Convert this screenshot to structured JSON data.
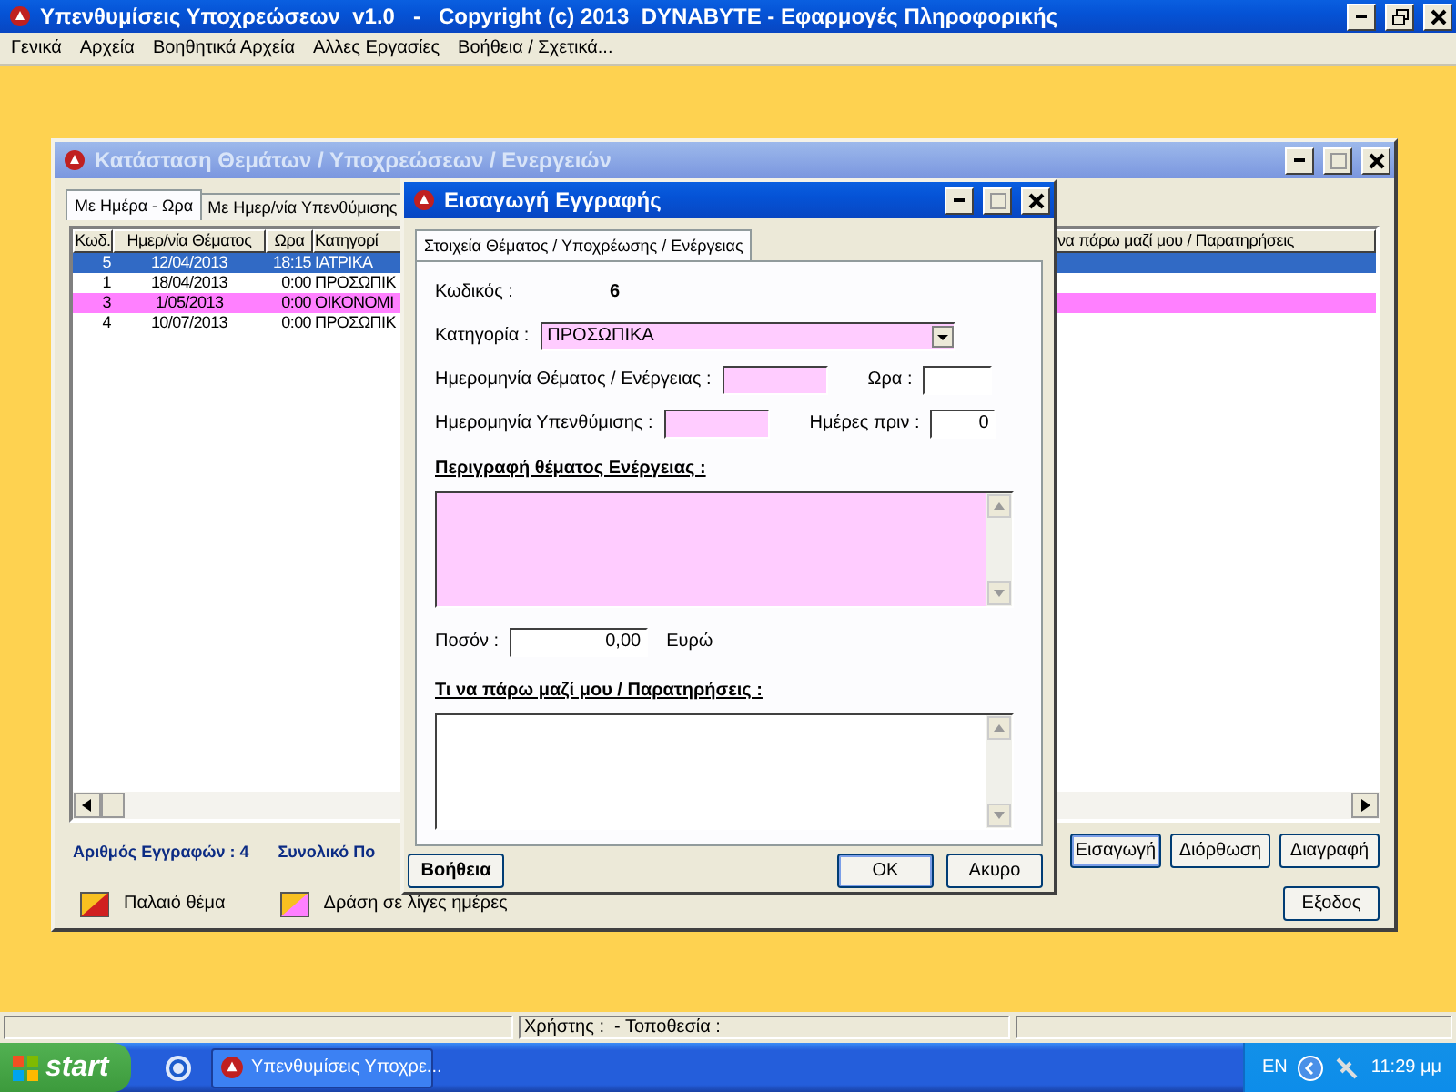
{
  "app": {
    "title": "Υπενθυμίσεις Υποχρεώσεων  v1.0   -   Copyright (c) 2013  DYNABYTE - Εφαρμογές Πληροφορικής"
  },
  "menu": [
    "Γενικά",
    "Αρχεία",
    "Βοηθητικά Αρχεία",
    "Αλλες Εργασίες",
    "Βοήθεια / Σχετικά..."
  ],
  "list_window": {
    "title": "Κατάσταση Θεμάτων / Υποχρεώσεων / Ενεργειών",
    "tabs": [
      {
        "label": "Με Ημέρα - Ωρα",
        "selected": true
      },
      {
        "label": "Με Ημερ/νία Υπενθύμισης",
        "selected": false
      }
    ],
    "columns": [
      "Κωδ.",
      "Ημερ/νία Θέματος",
      "Ωρα",
      "Κατηγορί",
      "να πάρω μαζί μου / Παρατηρήσεις"
    ],
    "rows": [
      {
        "code": "5",
        "date": "12/04/2013",
        "time": "18:15",
        "category": "ΙΑΤΡΙΚΑ",
        "selected": true,
        "kind": "normal"
      },
      {
        "code": "1",
        "date": "18/04/2013",
        "time": "0:00",
        "category": "ΠΡΟΣΩΠΙΚ",
        "selected": false,
        "kind": "normal"
      },
      {
        "code": "3",
        "date": "1/05/2013",
        "time": "0:00",
        "category": "ΟΙΚΟΝΟΜΙ",
        "selected": false,
        "kind": "soon"
      },
      {
        "code": "4",
        "date": "10/07/2013",
        "time": "0:00",
        "category": "ΠΡΟΣΩΠΙΚ",
        "selected": false,
        "kind": "normal"
      }
    ],
    "record_count": "Αριθμός Εγγραφών : 4",
    "total": "Συνολικό Πο",
    "buttons": [
      "Εισαγωγή",
      "Διόρθωση",
      "Διαγραφή"
    ],
    "legend": [
      {
        "kind": "old",
        "label": "Παλαιό θέμα"
      },
      {
        "kind": "soon",
        "label": "Δράση σε λίγες ημέρες"
      }
    ],
    "exit_button": "Εξοδος"
  },
  "dialog": {
    "title": "Εισαγωγή Εγγραφής",
    "tab": {
      "label": "Στοιχεία Θέματος / Υποχρέωσης / Ενέργειας",
      "selected": true
    },
    "code_label": "Κωδικός :",
    "code": "6",
    "category_label": "Κατηγορία :",
    "category": "ΠΡΟΣΩΠΙΚΑ",
    "date_label": "Ημερομηνία Θέματος / Ενέργειας :",
    "date_highlighted": true,
    "time_label": "Ωρα :",
    "time_highlighted": false,
    "reminder_label": "Ημερομηνία Υπενθύμισης :",
    "reminder_highlighted": true,
    "days_label": "Ημέρες πριν :",
    "days": "0",
    "description_label": "Περιγραφή θέματος Ενέργειας :",
    "description_highlighted": true,
    "amount_label": "Ποσόν :",
    "amount": "0,00",
    "currency": "Ευρώ",
    "notes_label": "Τι να πάρω μαζί μου / Παρατηρήσεις :",
    "notes_highlighted": false,
    "help_button": "Βοήθεια",
    "ok_button": "OK",
    "cancel_button": "Ακυρο"
  },
  "status_bar": {
    "user_location": "Χρήστης :  - Τοποθεσία :"
  },
  "taskbar": {
    "start": "start",
    "task": "Υπενθυμίσεις Υποχρε...",
    "language": "EN",
    "clock": "11:29 μμ"
  }
}
